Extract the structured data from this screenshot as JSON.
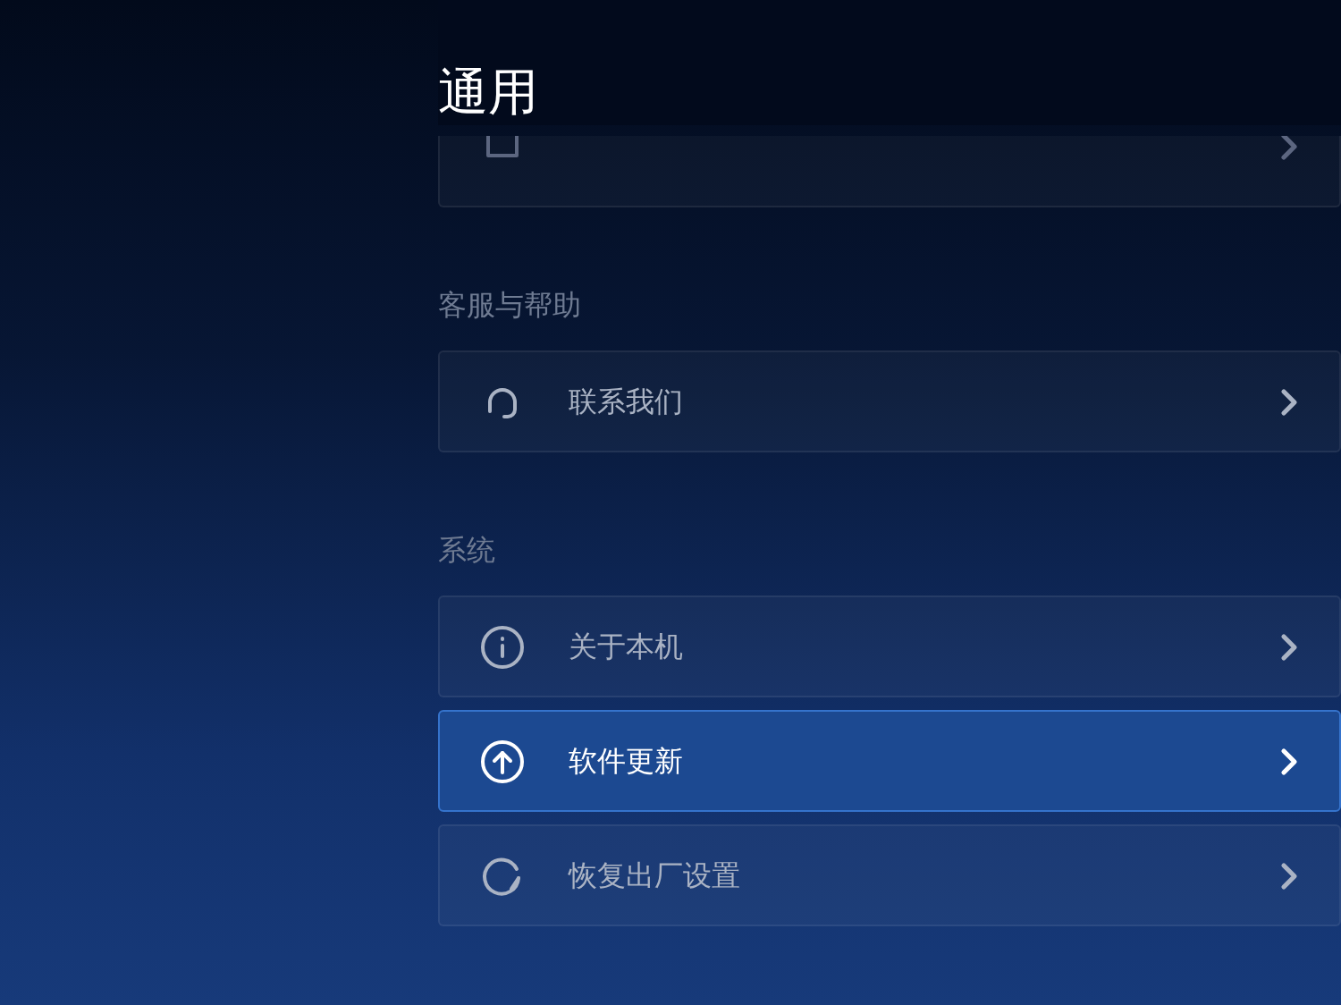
{
  "title": "通用",
  "sections": [
    {
      "items": [
        {
          "kind": "square"
        }
      ]
    },
    {
      "label": "客服与帮助",
      "items": [
        {
          "kind": "headset",
          "label": "联系我们",
          "selected": false
        }
      ]
    },
    {
      "label": "系统",
      "items": [
        {
          "kind": "info",
          "label": "关于本机",
          "selected": false
        },
        {
          "kind": "upload",
          "label": "软件更新",
          "selected": true
        },
        {
          "kind": "reset",
          "label": "恢复出厂设置",
          "selected": false
        }
      ]
    }
  ]
}
